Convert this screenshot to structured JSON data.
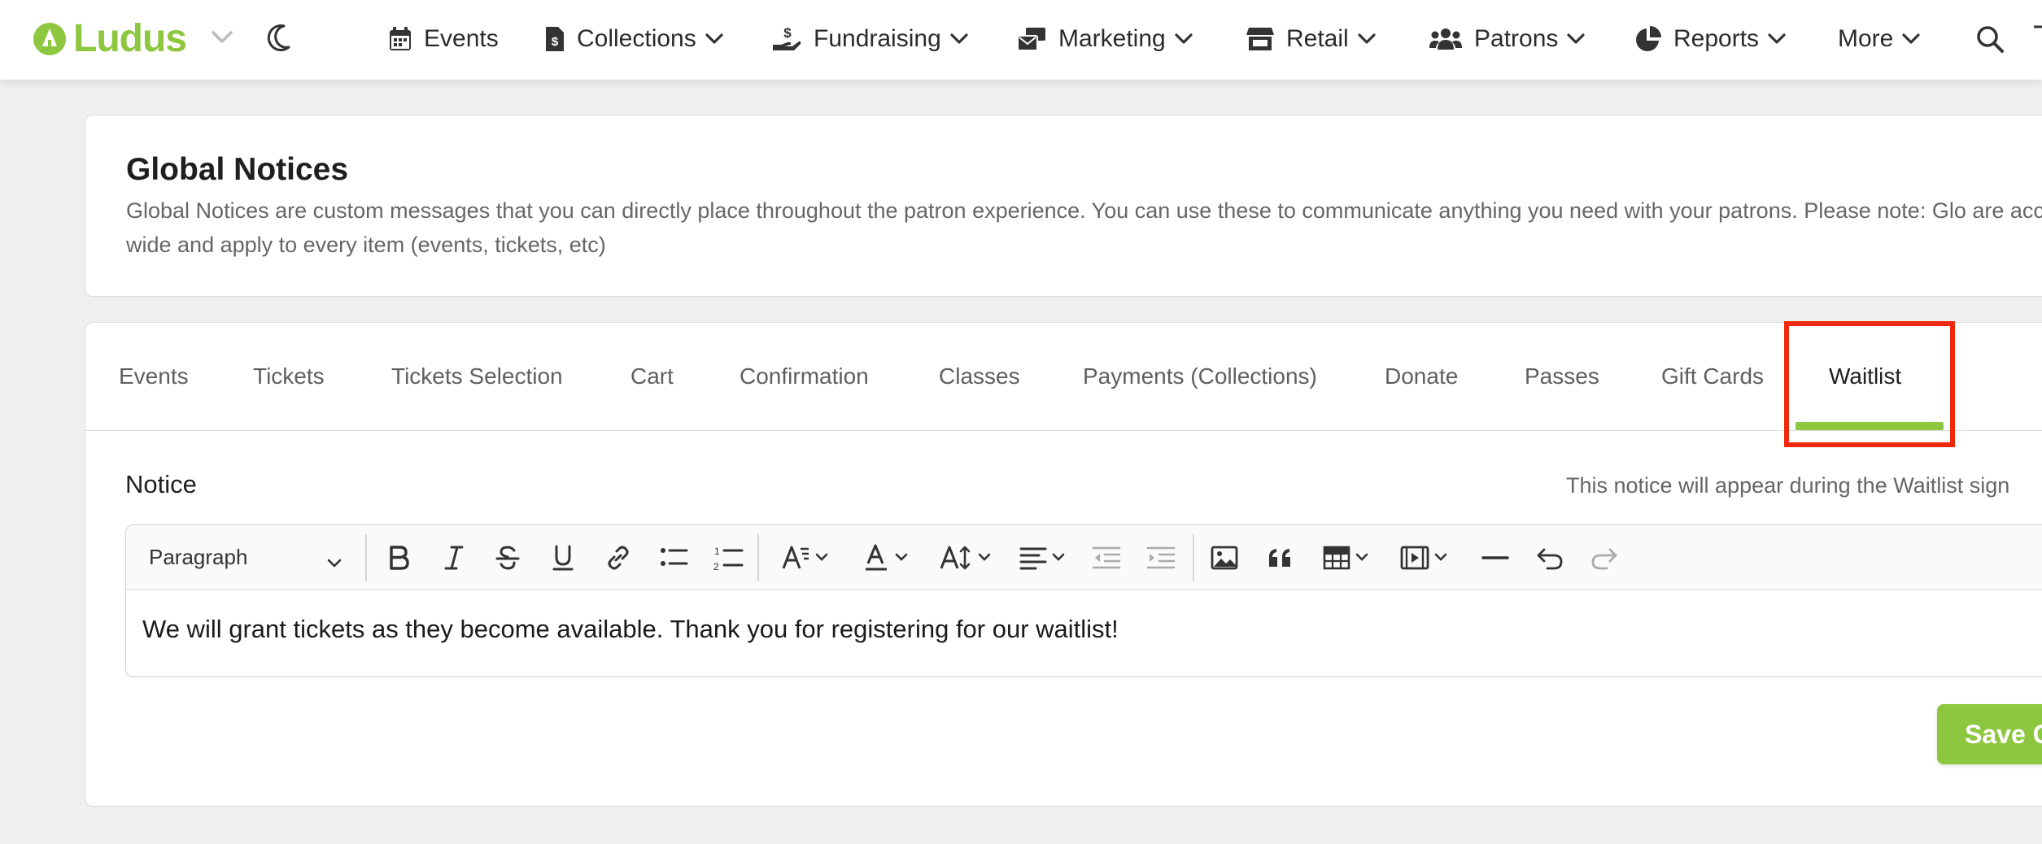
{
  "app": {
    "logo_text": "Ludus",
    "brand_color": "#8dc63f",
    "highlight_color": "#ee2a0b"
  },
  "nav": {
    "items": [
      {
        "label": "Events",
        "icon": "calendar-icon",
        "has_dropdown": false
      },
      {
        "label": "Collections",
        "icon": "receipt-dollar-icon",
        "has_dropdown": true
      },
      {
        "label": "Fundraising",
        "icon": "hand-dollar-icon",
        "has_dropdown": true
      },
      {
        "label": "Marketing",
        "icon": "mail-bulk-icon",
        "has_dropdown": true
      },
      {
        "label": "Retail",
        "icon": "store-icon",
        "has_dropdown": true
      },
      {
        "label": "Patrons",
        "icon": "users-icon",
        "has_dropdown": true
      },
      {
        "label": "Reports",
        "icon": "pie-chart-icon",
        "has_dropdown": true
      },
      {
        "label": "More",
        "icon": "",
        "has_dropdown": true
      }
    ]
  },
  "header": {
    "title": "Global Notices",
    "description": "Global Notices are custom messages that you can directly place throughout the patron experience. You can use these to communicate anything you need with your patrons. Please note: Glo are account wide and apply to every item (events, tickets, etc)"
  },
  "tabs": [
    {
      "label": "Events",
      "active": false
    },
    {
      "label": "Tickets",
      "active": false
    },
    {
      "label": "Tickets Selection",
      "active": false
    },
    {
      "label": "Cart",
      "active": false
    },
    {
      "label": "Confirmation",
      "active": false
    },
    {
      "label": "Classes",
      "active": false
    },
    {
      "label": "Payments (Collections)",
      "active": false
    },
    {
      "label": "Donate",
      "active": false
    },
    {
      "label": "Passes",
      "active": false
    },
    {
      "label": "Gift Cards",
      "active": false
    },
    {
      "label": "Waitlist",
      "active": true
    }
  ],
  "notice": {
    "label": "Notice",
    "hint": "This notice will appear during the Waitlist sign",
    "editor": {
      "block_format": "Paragraph",
      "toolbar_icons": [
        "bold-icon",
        "italic-icon",
        "strikethrough-icon",
        "underline-icon",
        "link-icon",
        "bulleted-list-icon",
        "numbered-list-icon",
        "font-family-icon",
        "font-color-icon",
        "font-size-icon",
        "align-icon",
        "outdent-icon",
        "indent-icon",
        "image-icon",
        "blockquote-icon",
        "table-icon",
        "media-icon",
        "horizontal-line-icon",
        "undo-icon",
        "redo-icon"
      ],
      "content": "We will grant tickets as they become available. Thank you for registering for our waitlist!"
    }
  },
  "actions": {
    "save_label": "Save C"
  }
}
